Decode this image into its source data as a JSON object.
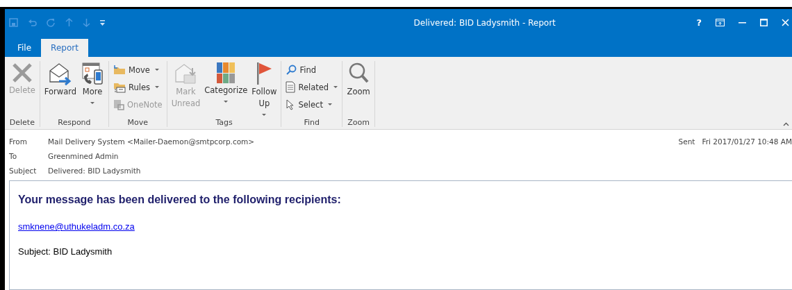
{
  "window": {
    "title": "Delivered: BID Ladysmith - Report",
    "help": "?"
  },
  "tabs": [
    {
      "label": "File",
      "selected": false
    },
    {
      "label": "Report",
      "selected": true
    }
  ],
  "ribbon": [
    {
      "label": "Delete",
      "items": [
        {
          "label": "Delete",
          "kind": "large",
          "disabled": true
        }
      ]
    },
    {
      "label": "Respond",
      "items": [
        {
          "label": "Forward",
          "kind": "large",
          "disabled": false
        },
        {
          "label": "More",
          "kind": "large",
          "disabled": false,
          "dropdown": true
        }
      ]
    },
    {
      "label": "Move",
      "items": [
        {
          "label": "Move",
          "kind": "small",
          "disabled": false,
          "dropdown": true
        },
        {
          "label": "Rules",
          "kind": "small",
          "disabled": false,
          "dropdown": true
        },
        {
          "label": "OneNote",
          "kind": "small",
          "disabled": true
        }
      ]
    },
    {
      "label": "Tags",
      "items": [
        {
          "label": "Mark Unread",
          "kind": "large",
          "disabled": true
        },
        {
          "label": "Categorize",
          "kind": "large",
          "disabled": false,
          "dropdown": true
        },
        {
          "label": "Follow Up",
          "kind": "large",
          "disabled": false,
          "dropdown": true
        }
      ]
    },
    {
      "label": "Find",
      "items": [
        {
          "label": "Find",
          "kind": "small",
          "disabled": false
        },
        {
          "label": "Related",
          "kind": "small",
          "disabled": false,
          "dropdown": true
        },
        {
          "label": "Select",
          "kind": "small",
          "disabled": false,
          "dropdown": true
        }
      ]
    },
    {
      "label": "Zoom",
      "items": [
        {
          "label": "Zoom",
          "kind": "large",
          "disabled": false
        }
      ]
    }
  ],
  "header": {
    "fields": [
      {
        "label": "From",
        "value": "Mail Delivery System <Mailer-Daemon@smtpcorp.com>"
      },
      {
        "label": "To",
        "value": "Greenmined Admin"
      },
      {
        "label": "Subject",
        "value": "Delivered: BID Ladysmith"
      }
    ],
    "sent": {
      "label": "Sent",
      "value": "Fri 2017/01/27 10:48 AM"
    }
  },
  "body": {
    "heading": "Your message has been delivered to the following recipients:",
    "recipient": "smknene@uthukeladm.co.za",
    "subject_line": "Subject: BID Ladysmith"
  }
}
